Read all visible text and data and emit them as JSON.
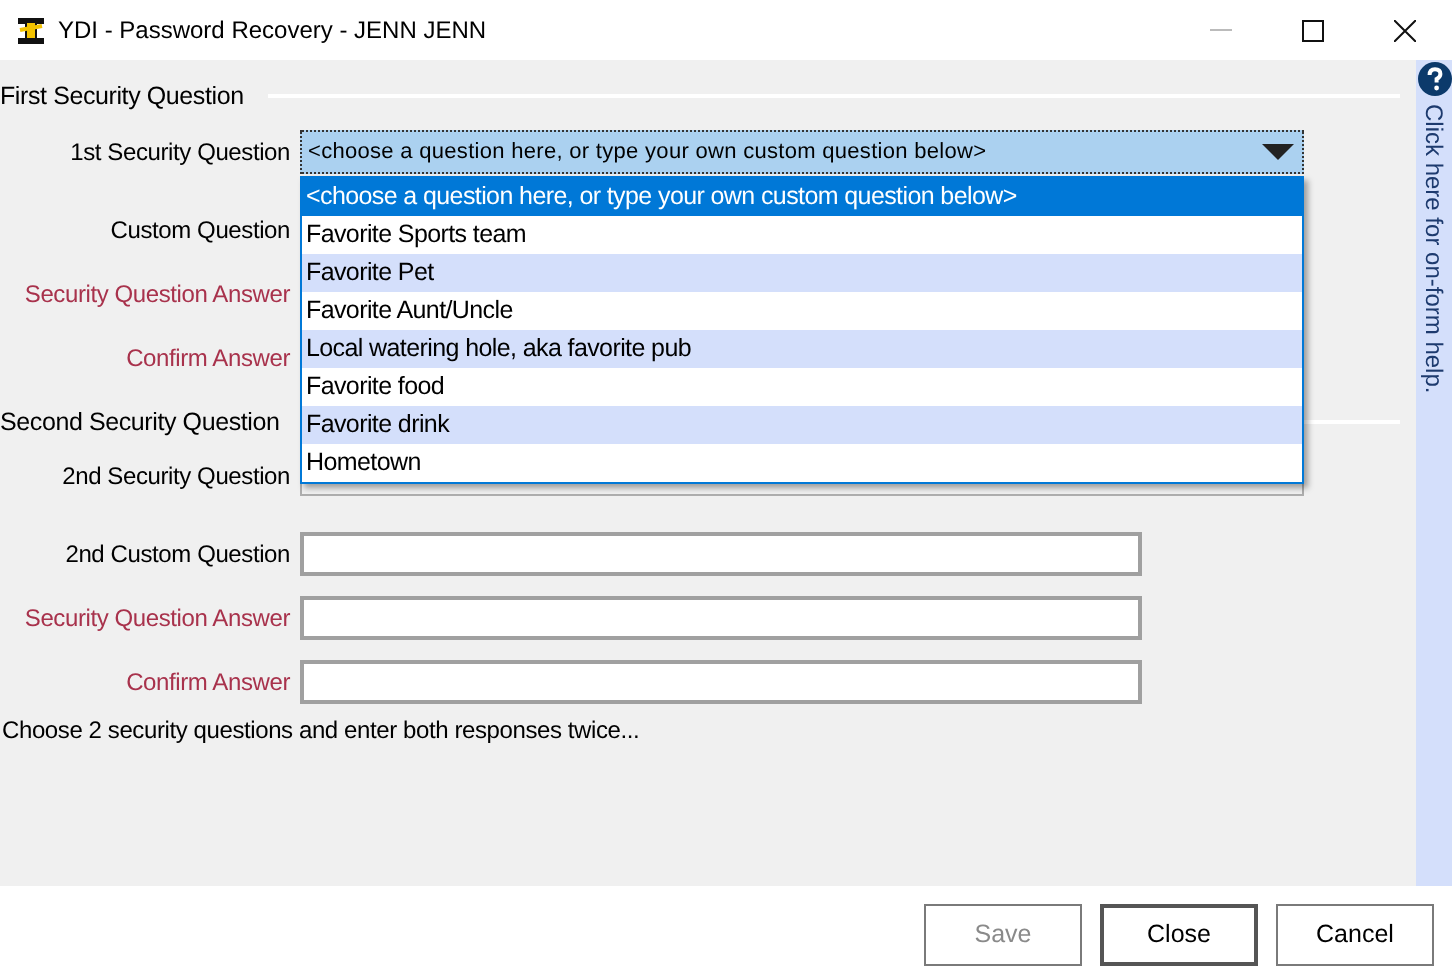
{
  "window": {
    "title": "YDI - Password Recovery - JENN JENN"
  },
  "first_section": {
    "heading": "First Security Question",
    "question_label": "1st Security Question",
    "question_value": "<choose a question here, or type your own custom question below>",
    "fields": [
      {
        "label": "Custom Question",
        "required": false
      },
      {
        "label": "Security Question Answer",
        "required": true
      },
      {
        "label": "Confirm Answer",
        "required": true
      }
    ]
  },
  "dropdown": {
    "expanded": true,
    "options": [
      {
        "label": "<choose a question here, or type your own custom question below>",
        "selected": true
      },
      {
        "label": "Favorite Sports team",
        "selected": false
      },
      {
        "label": "Favorite Pet",
        "selected": false
      },
      {
        "label": "Favorite Aunt/Uncle",
        "selected": false
      },
      {
        "label": "Local watering hole, aka favorite pub",
        "selected": false
      },
      {
        "label": "Favorite food",
        "selected": false
      },
      {
        "label": "Favorite drink",
        "selected": false
      },
      {
        "label": "Hometown",
        "selected": false
      }
    ]
  },
  "second_section": {
    "heading": "Second Security Question",
    "question_label": "2nd Security Question",
    "fields": [
      {
        "label": "2nd Custom Question",
        "required": false
      },
      {
        "label": "Security Question Answer",
        "required": true
      },
      {
        "label": "Confirm Answer",
        "required": true
      }
    ]
  },
  "hint": "Choose 2 security questions and enter both responses twice...",
  "help_panel": {
    "text": "Click here for on-form help."
  },
  "buttons": [
    {
      "label": "Save",
      "disabled": true,
      "default": false
    },
    {
      "label": "Close",
      "disabled": false,
      "default": true
    },
    {
      "label": "Cancel",
      "disabled": false,
      "default": false
    }
  ]
}
